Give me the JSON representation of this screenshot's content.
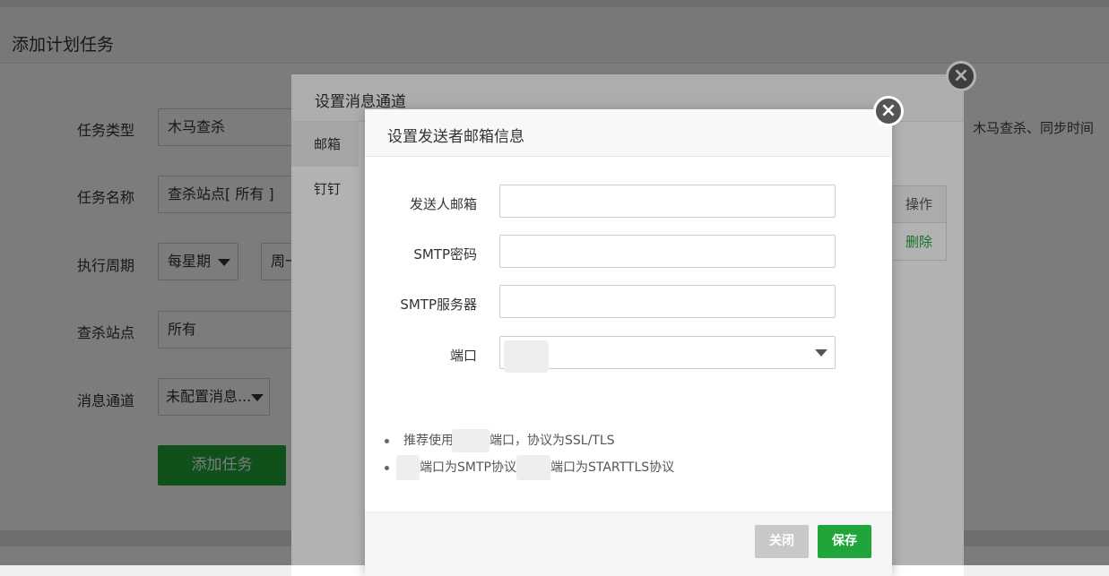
{
  "page": {
    "title": "添加计划任务",
    "fields": {
      "task_type_label": "任务类型",
      "task_type_value": "木马查杀",
      "task_name_label": "任务名称",
      "task_name_value": "查杀站点[ 所有 ]",
      "period_label": "执行周期",
      "period_value": "每星期",
      "weekday_value": "周一",
      "site_label": "查杀站点",
      "site_value": "所有",
      "channel_label": "消息通道",
      "channel_value": "未配置消息..."
    },
    "add_button": "添加任务",
    "right_hint": "木马查杀、同步时间"
  },
  "modal_channel": {
    "title": "设置消息通道",
    "tabs": [
      "邮箱",
      "钉钉"
    ],
    "table_header": "操作",
    "table_action": "删除"
  },
  "modal_email": {
    "title": "设置发送者邮箱信息",
    "fields": {
      "sender_email_label": "发送人邮箱",
      "sender_email_value": "",
      "smtp_password_label": "SMTP密码",
      "smtp_password_value": "",
      "smtp_server_label": "SMTP服务器",
      "smtp_server_value": "",
      "port_label": "端口"
    },
    "tips": {
      "tip1_before": "推荐使用",
      "tip1_after": "端口，协议为SSL/TLS",
      "tip2_part1": "端口为SMTP协议",
      "tip2_part2": "端口为STARTTLS协议"
    },
    "close_button": "关闭",
    "save_button": "保存"
  },
  "colors": {
    "accent_green": "#20a53a",
    "overlay": "rgba(0,0,0,0.3)",
    "disabled_button": "#c8c8c8"
  }
}
